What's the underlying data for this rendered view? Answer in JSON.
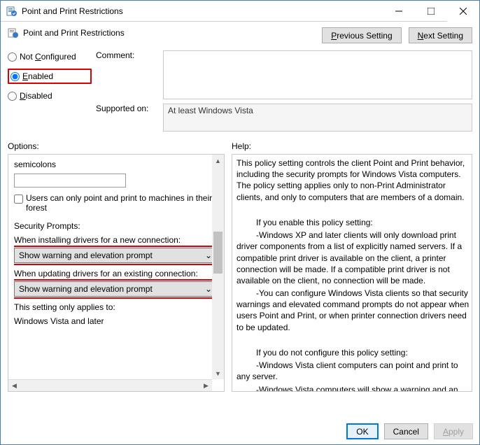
{
  "window": {
    "title": "Point and Print Restrictions"
  },
  "header": {
    "title": "Point and Print Restrictions"
  },
  "nav": {
    "prev": "Previous Setting",
    "next": "Next Setting"
  },
  "radios": {
    "not_configured": "Not Configured",
    "enabled": "Enabled",
    "disabled": "Disabled",
    "selected": "enabled"
  },
  "labels": {
    "comment": "Comment:",
    "supported": "Supported on:",
    "options": "Options:",
    "help": "Help:"
  },
  "supported_value": "At least Windows Vista",
  "options": {
    "semicolons": "semicolons",
    "checkbox_label": "Users can only point and print to machines in their forest",
    "security_prompts": "Security Prompts:",
    "install_label": "When installing drivers for a new connection:",
    "install_value": "Show warning and elevation prompt",
    "update_label": "When updating drivers for an existing connection:",
    "update_value": "Show warning and elevation prompt",
    "applies_label": "This setting only applies to:",
    "applies_value": "Windows Vista and later"
  },
  "help": {
    "p1": "This policy setting controls the client Point and Print behavior, including the security prompts for Windows Vista computers. The policy setting applies only to non-Print Administrator clients, and only to computers that are members of a domain.",
    "p2": "If you enable this policy setting:",
    "p3": "-Windows XP and later clients will only download print driver components from a list of explicitly named servers. If a compatible print driver is available on the client, a printer connection will be made. If a compatible print driver is not available on the client, no connection will be made.",
    "p4": "-You can configure Windows Vista clients so that security warnings and elevated command prompts do not appear when users Point and Print, or when printer connection drivers need to be updated.",
    "p5": "If you do not configure this policy setting:",
    "p6": "-Windows Vista client computers can point and print to any server.",
    "p7": "-Windows Vista computers will show a warning and an elevated command prompt when users create a printer"
  },
  "footer": {
    "ok": "OK",
    "cancel": "Cancel",
    "apply": "Apply"
  }
}
